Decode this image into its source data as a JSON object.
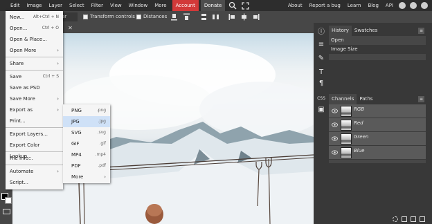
{
  "menubar": {
    "items": [
      "Edit",
      "Image",
      "Layer",
      "Select",
      "Filter",
      "View",
      "Window",
      "More"
    ],
    "account": "Account",
    "donate": "Donate",
    "right_links": [
      "About",
      "Report a bug",
      "Learn",
      "Blog",
      "API"
    ],
    "account_color": "#d23939"
  },
  "toolbar": {
    "select_value": "er",
    "transform_controls": "Transform controls",
    "distances": "Distances"
  },
  "file_menu": {
    "items": [
      {
        "label": "New...",
        "shortcut": "Alt+Ctrl + N"
      },
      {
        "label": "Open...",
        "shortcut": "Ctrl + O"
      },
      {
        "label": "Open & Place..."
      },
      {
        "label": "Open More"
      },
      {
        "label": "Share"
      },
      {
        "label": "Save",
        "shortcut": "Ctrl + S"
      },
      {
        "label": "Save as PSD"
      },
      {
        "label": "Save More"
      },
      {
        "label": "Export as"
      },
      {
        "label": "Print..."
      },
      {
        "label": "Export Layers..."
      },
      {
        "label": "Export Color Lookup..."
      },
      {
        "label": "File Info..."
      },
      {
        "label": "Automate"
      },
      {
        "label": "Script..."
      }
    ]
  },
  "export_menu": {
    "items": [
      {
        "label": "PNG",
        "ext": ".png"
      },
      {
        "label": "JPG",
        "ext": ".jpg"
      },
      {
        "label": "SVG",
        "ext": ".svg"
      },
      {
        "label": "GIF",
        "ext": ".gif"
      },
      {
        "label": "MP4",
        "ext": ".mp4"
      },
      {
        "label": "PDF",
        "ext": ".pdf"
      },
      {
        "label": "More"
      }
    ],
    "highlight_color": "#cfe1f7"
  },
  "history_panel": {
    "tabs": [
      "History",
      "Swatches"
    ],
    "entries": [
      "Open",
      "Image Size"
    ]
  },
  "channels_panel": {
    "tabs": [
      "Channels",
      "Paths"
    ],
    "channels": [
      "RGB",
      "Red",
      "Green",
      "Blue"
    ]
  }
}
